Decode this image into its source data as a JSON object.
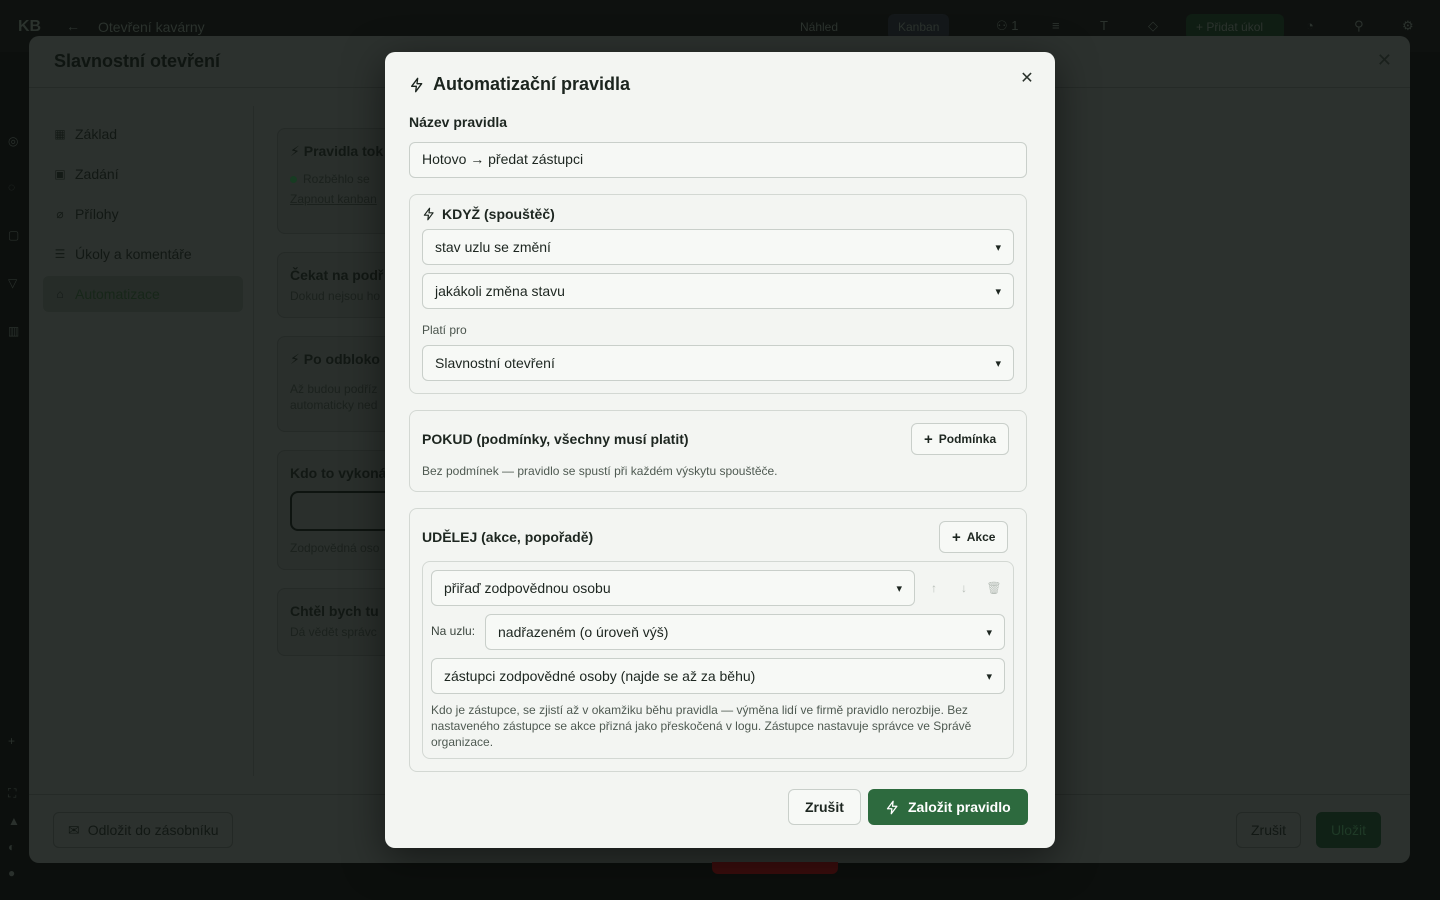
{
  "topbar": {
    "logo": "KB",
    "back_icon": "arrow-left-icon",
    "title": "Otevření kavárny",
    "preview_label": "Náhled",
    "kanban_label": "Kanban",
    "count": "1",
    "add_label": "Přidat úkol"
  },
  "backwindow": {
    "title": "Slavnostní otevření",
    "nav": [
      {
        "label": "Základ",
        "icon": "grid-icon"
      },
      {
        "label": "Zadání",
        "icon": "calendar-icon"
      },
      {
        "label": "Přílohy",
        "icon": "paperclip-icon"
      },
      {
        "label": "Úkoly a komentáře",
        "icon": "list-icon"
      },
      {
        "label": "Automatizace",
        "icon": "robot-icon"
      }
    ],
    "cards": [
      {
        "title": "Pravidla tok",
        "status": "Rozběhlo se",
        "link": "Zapnout kanban"
      },
      {
        "title": "Čekat na podř",
        "sub": "Dokud nejsou ho"
      },
      {
        "title": "Po odbloko",
        "sub": "Až budou podříz",
        "sub2": "automaticky ned"
      },
      {
        "title": "Kdo to vykoná",
        "sub": "Zodpovědná oso"
      },
      {
        "title": "Chtěl bych tu",
        "sub": "Dá vědět správc"
      }
    ],
    "stash_button": "Odložit do zásobníku",
    "cancel_button": "Zrušit",
    "save_button": "Uložit"
  },
  "modal": {
    "title": "Automatizační pravidla",
    "name_label": "Název pravidla",
    "name_value": "Hotovo → předat zástupci",
    "when": {
      "heading": "KDYŽ (spouštěč)",
      "trigger": "stav uzlu se změní",
      "change": "jakákoli změna stavu",
      "applies_label": "Platí pro",
      "applies_value": "Slavnostní otevření"
    },
    "if": {
      "heading": "POKUD (podmínky, všechny musí platit)",
      "add_button": "Podmínka",
      "hint": "Bez podmínek — pravidlo se spustí při každém výskytu spouštěče."
    },
    "do": {
      "heading": "UDĚLEJ (akce, popořadě)",
      "add_button": "Akce",
      "action": "přiřaď zodpovědnou osobu",
      "node_label": "Na uzlu:",
      "node_value": "nadřazeném (o úroveň výš)",
      "target_value": "zástupci zodpovědné osoby (najde se až za běhu)",
      "hint": "Kdo je zástupce, se zjistí až v okamžiku běhu pravidla — výměna lidí ve firmě pravidlo nerozbije. Bez nastaveného zástupce se akce přizná jako přeskočená v logu. Zástupce nastavuje správce ve Správě organizace."
    },
    "cancel_button": "Zrušit",
    "create_button": "Založit pravidlo"
  },
  "colors": {
    "accent": "#2d6a3e",
    "modal_bg": "#f3f5f2",
    "backdrop": "#0c0f0d"
  }
}
